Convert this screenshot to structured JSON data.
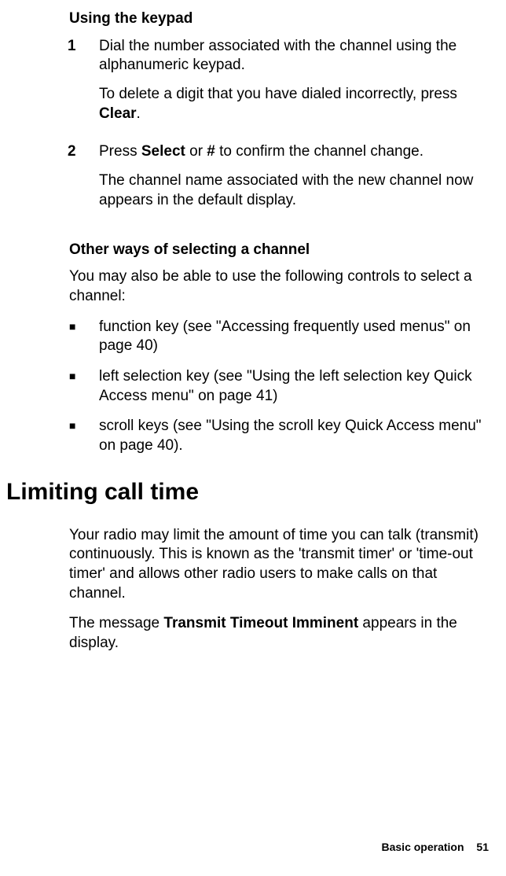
{
  "section_keypad": {
    "heading": "Using the keypad",
    "step1": {
      "num": "1",
      "text1_a": "Dial the number associated with the channel using the alphanumeric keypad.",
      "text2_a": "To delete a digit that you have dialed incorrectly, press ",
      "text2_b": "Clear",
      "text2_c": "."
    },
    "step2": {
      "num": "2",
      "text1_a": "Press ",
      "text1_b": "Select",
      "text1_c": " or ",
      "text1_d": "#",
      "text1_e": " to confirm the channel change.",
      "text2": "The channel name associated with the new channel now appears in the default display."
    }
  },
  "section_other": {
    "heading": "Other ways of selecting a channel",
    "intro": "You may also be able to use the following controls to select a channel:",
    "bullets": [
      "function key (see \"Accessing frequently used menus\" on page 40)",
      "left selection key (see \"Using the left selection key Quick Access menu\" on page 41)",
      "scroll keys (see \"Using the scroll key Quick Access menu\" on page 40)."
    ]
  },
  "section_limiting": {
    "heading": "Limiting call time",
    "para1": "Your radio may limit the amount of time you can talk (transmit) continuously. This is known as the 'transmit timer' or 'time-out timer' and allows other radio users to make calls on that channel.",
    "para2_a": "The message ",
    "para2_b": "Transmit Timeout Imminent",
    "para2_c": " appears in the display."
  },
  "footer": {
    "label": "Basic operation",
    "page": "51"
  }
}
